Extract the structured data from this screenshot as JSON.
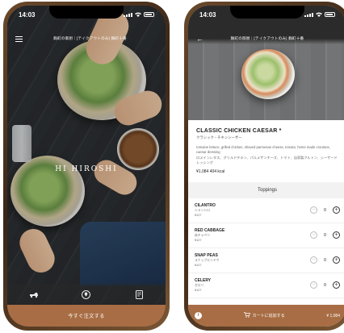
{
  "left": {
    "status": {
      "time": "14:03"
    },
    "header": {
      "title": "麹町の御厨｜[テイクアウトのみ] 麹町十番"
    },
    "brand": "HI HIROSHI",
    "order_button": "今すぐ注文する",
    "tabs": [
      {
        "icon": "delivery-icon"
      },
      {
        "icon": "location-pin-icon"
      },
      {
        "icon": "receipt-icon"
      }
    ]
  },
  "right": {
    "status": {
      "time": "14:03"
    },
    "header": {
      "title": "麹町の御厨｜[テイクアウトのみ] 麹町十番"
    },
    "product": {
      "name": "CLASSIC CHICKEN CAESAR *",
      "name_jp": "クラシック・チキンシーザー",
      "description": "romaine lettuce, grilled chicken, shaved parmesan cheese, tomato, home made croutons, caesar dressing",
      "description_jp": "ロメインレタス、グリルドチキン、パルメザンチーズ、トマト、自家製クルトン、シーザードレッシング",
      "price": "¥1,084  404 kcal"
    },
    "section_title": "Toppings",
    "toppings": [
      {
        "name": "CILANTRO",
        "jp": "シラントロ",
        "price": "¥127",
        "qty": "0"
      },
      {
        "name": "RED CABBAGE",
        "jp": "赤キャベツ",
        "price": "¥127",
        "qty": "0"
      },
      {
        "name": "SNAP PEAS",
        "jp": "スナップエンドウ",
        "price": "¥127",
        "qty": "0"
      },
      {
        "name": "CELERY",
        "jp": "セロリ",
        "price": "¥127",
        "qty": "0"
      }
    ],
    "cart": {
      "label": "カートに追加する",
      "total": "¥ 1,084"
    }
  },
  "colors": {
    "accent": "#a86d44",
    "frame": "#5a3b22"
  }
}
